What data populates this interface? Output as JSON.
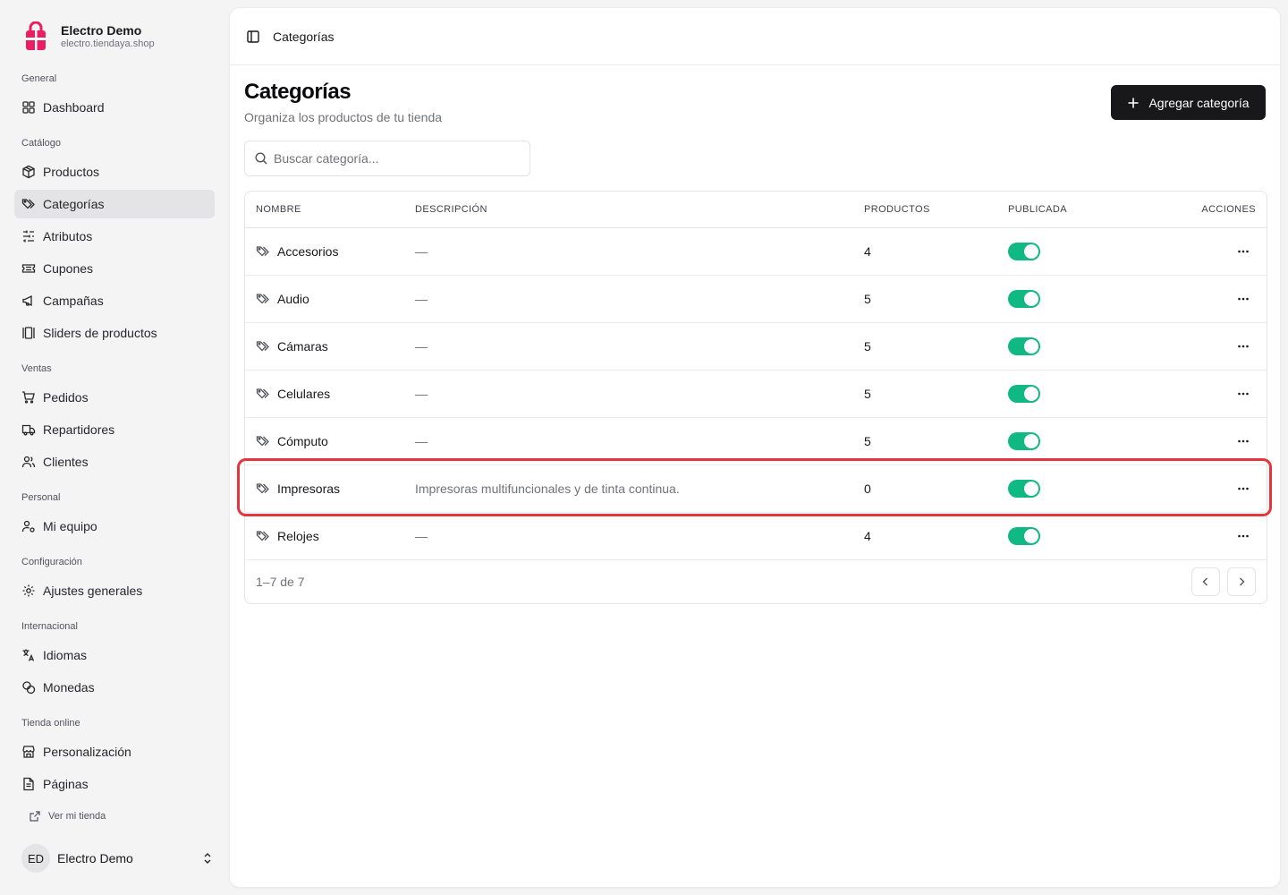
{
  "brand": {
    "name": "Electro Demo",
    "url": "electro.tiendaya.shop",
    "accent": "#e91e63"
  },
  "nav": {
    "groups": [
      {
        "title": "General",
        "items": [
          {
            "label": "Dashboard",
            "icon": "grid-icon"
          }
        ]
      },
      {
        "title": "Catálogo",
        "items": [
          {
            "label": "Productos",
            "icon": "box-icon"
          },
          {
            "label": "Categorías",
            "icon": "tags-icon",
            "active": true
          },
          {
            "label": "Atributos",
            "icon": "sliders-icon"
          },
          {
            "label": "Cupones",
            "icon": "ticket-icon"
          },
          {
            "label": "Campañas",
            "icon": "megaphone-icon"
          },
          {
            "label": "Sliders de productos",
            "icon": "gallery-icon"
          }
        ]
      },
      {
        "title": "Ventas",
        "items": [
          {
            "label": "Pedidos",
            "icon": "cart-icon"
          },
          {
            "label": "Repartidores",
            "icon": "truck-icon"
          },
          {
            "label": "Clientes",
            "icon": "users-icon"
          }
        ]
      },
      {
        "title": "Personal",
        "items": [
          {
            "label": "Mi equipo",
            "icon": "user-cog-icon"
          }
        ]
      },
      {
        "title": "Configuración",
        "items": [
          {
            "label": "Ajustes generales",
            "icon": "gear-icon"
          }
        ]
      },
      {
        "title": "Internacional",
        "items": [
          {
            "label": "Idiomas",
            "icon": "languages-icon"
          },
          {
            "label": "Monedas",
            "icon": "coins-icon"
          }
        ]
      },
      {
        "title": "Tienda online",
        "items": [
          {
            "label": "Personalización",
            "icon": "store-icon"
          },
          {
            "label": "Páginas",
            "icon": "file-icon"
          }
        ]
      }
    ],
    "view_store": "Ver mi tienda"
  },
  "user": {
    "initials": "ED",
    "name": "Electro Demo"
  },
  "topbar": {
    "title": "Categorías"
  },
  "page": {
    "title": "Categorías",
    "subtitle": "Organiza los productos de tu tienda",
    "add_button": "Agregar categoría",
    "search_placeholder": "Buscar categoría..."
  },
  "table": {
    "headers": {
      "name": "NOMBRE",
      "description": "DESCRIPCIÓN",
      "products": "PRODUCTOS",
      "published": "PUBLICADA",
      "actions": "ACCIONES"
    },
    "rows": [
      {
        "name": "Accesorios",
        "description": "—",
        "products": "4",
        "published": true
      },
      {
        "name": "Audio",
        "description": "—",
        "products": "5",
        "published": true
      },
      {
        "name": "Cámaras",
        "description": "—",
        "products": "5",
        "published": true
      },
      {
        "name": "Celulares",
        "description": "—",
        "products": "5",
        "published": true
      },
      {
        "name": "Cómputo",
        "description": "—",
        "products": "5",
        "published": true
      },
      {
        "name": "Impresoras",
        "description": "Impresoras multifuncionales y de tinta continua.",
        "products": "0",
        "published": true
      },
      {
        "name": "Relojes",
        "description": "—",
        "products": "4",
        "published": true
      }
    ],
    "pagination": "1–7 de 7"
  },
  "colors": {
    "toggle_on": "#10b981",
    "primary": "#18181b",
    "highlight": "#e5343b"
  }
}
